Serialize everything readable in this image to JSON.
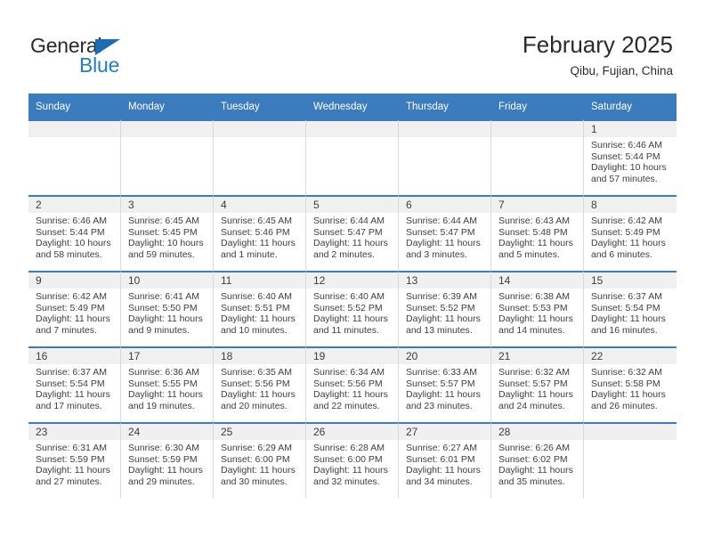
{
  "logo": {
    "word1": "General",
    "word2": "Blue",
    "triangle_color": "#1c6cb5",
    "blue_color": "#1f7ec4"
  },
  "header": {
    "title": "February 2025",
    "subtitle": "Qibu, Fujian, China"
  },
  "theme": {
    "header_bg": "#3a7cbe",
    "daynum_bg": "#f0f0f0",
    "cell_border": "#d9d9d9"
  },
  "weekday_headers": [
    "Sunday",
    "Monday",
    "Tuesday",
    "Wednesday",
    "Thursday",
    "Friday",
    "Saturday"
  ],
  "weeks": [
    [
      {
        "day": "",
        "lines": []
      },
      {
        "day": "",
        "lines": []
      },
      {
        "day": "",
        "lines": []
      },
      {
        "day": "",
        "lines": []
      },
      {
        "day": "",
        "lines": []
      },
      {
        "day": "",
        "lines": []
      },
      {
        "day": "1",
        "lines": [
          "Sunrise: 6:46 AM",
          "Sunset: 5:44 PM",
          "Daylight: 10 hours",
          "and 57 minutes."
        ]
      }
    ],
    [
      {
        "day": "2",
        "lines": [
          "Sunrise: 6:46 AM",
          "Sunset: 5:44 PM",
          "Daylight: 10 hours",
          "and 58 minutes."
        ]
      },
      {
        "day": "3",
        "lines": [
          "Sunrise: 6:45 AM",
          "Sunset: 5:45 PM",
          "Daylight: 10 hours",
          "and 59 minutes."
        ]
      },
      {
        "day": "4",
        "lines": [
          "Sunrise: 6:45 AM",
          "Sunset: 5:46 PM",
          "Daylight: 11 hours",
          "and 1 minute."
        ]
      },
      {
        "day": "5",
        "lines": [
          "Sunrise: 6:44 AM",
          "Sunset: 5:47 PM",
          "Daylight: 11 hours",
          "and 2 minutes."
        ]
      },
      {
        "day": "6",
        "lines": [
          "Sunrise: 6:44 AM",
          "Sunset: 5:47 PM",
          "Daylight: 11 hours",
          "and 3 minutes."
        ]
      },
      {
        "day": "7",
        "lines": [
          "Sunrise: 6:43 AM",
          "Sunset: 5:48 PM",
          "Daylight: 11 hours",
          "and 5 minutes."
        ]
      },
      {
        "day": "8",
        "lines": [
          "Sunrise: 6:42 AM",
          "Sunset: 5:49 PM",
          "Daylight: 11 hours",
          "and 6 minutes."
        ]
      }
    ],
    [
      {
        "day": "9",
        "lines": [
          "Sunrise: 6:42 AM",
          "Sunset: 5:49 PM",
          "Daylight: 11 hours",
          "and 7 minutes."
        ]
      },
      {
        "day": "10",
        "lines": [
          "Sunrise: 6:41 AM",
          "Sunset: 5:50 PM",
          "Daylight: 11 hours",
          "and 9 minutes."
        ]
      },
      {
        "day": "11",
        "lines": [
          "Sunrise: 6:40 AM",
          "Sunset: 5:51 PM",
          "Daylight: 11 hours",
          "and 10 minutes."
        ]
      },
      {
        "day": "12",
        "lines": [
          "Sunrise: 6:40 AM",
          "Sunset: 5:52 PM",
          "Daylight: 11 hours",
          "and 11 minutes."
        ]
      },
      {
        "day": "13",
        "lines": [
          "Sunrise: 6:39 AM",
          "Sunset: 5:52 PM",
          "Daylight: 11 hours",
          "and 13 minutes."
        ]
      },
      {
        "day": "14",
        "lines": [
          "Sunrise: 6:38 AM",
          "Sunset: 5:53 PM",
          "Daylight: 11 hours",
          "and 14 minutes."
        ]
      },
      {
        "day": "15",
        "lines": [
          "Sunrise: 6:37 AM",
          "Sunset: 5:54 PM",
          "Daylight: 11 hours",
          "and 16 minutes."
        ]
      }
    ],
    [
      {
        "day": "16",
        "lines": [
          "Sunrise: 6:37 AM",
          "Sunset: 5:54 PM",
          "Daylight: 11 hours",
          "and 17 minutes."
        ]
      },
      {
        "day": "17",
        "lines": [
          "Sunrise: 6:36 AM",
          "Sunset: 5:55 PM",
          "Daylight: 11 hours",
          "and 19 minutes."
        ]
      },
      {
        "day": "18",
        "lines": [
          "Sunrise: 6:35 AM",
          "Sunset: 5:56 PM",
          "Daylight: 11 hours",
          "and 20 minutes."
        ]
      },
      {
        "day": "19",
        "lines": [
          "Sunrise: 6:34 AM",
          "Sunset: 5:56 PM",
          "Daylight: 11 hours",
          "and 22 minutes."
        ]
      },
      {
        "day": "20",
        "lines": [
          "Sunrise: 6:33 AM",
          "Sunset: 5:57 PM",
          "Daylight: 11 hours",
          "and 23 minutes."
        ]
      },
      {
        "day": "21",
        "lines": [
          "Sunrise: 6:32 AM",
          "Sunset: 5:57 PM",
          "Daylight: 11 hours",
          "and 24 minutes."
        ]
      },
      {
        "day": "22",
        "lines": [
          "Sunrise: 6:32 AM",
          "Sunset: 5:58 PM",
          "Daylight: 11 hours",
          "and 26 minutes."
        ]
      }
    ],
    [
      {
        "day": "23",
        "lines": [
          "Sunrise: 6:31 AM",
          "Sunset: 5:59 PM",
          "Daylight: 11 hours",
          "and 27 minutes."
        ]
      },
      {
        "day": "24",
        "lines": [
          "Sunrise: 6:30 AM",
          "Sunset: 5:59 PM",
          "Daylight: 11 hours",
          "and 29 minutes."
        ]
      },
      {
        "day": "25",
        "lines": [
          "Sunrise: 6:29 AM",
          "Sunset: 6:00 PM",
          "Daylight: 11 hours",
          "and 30 minutes."
        ]
      },
      {
        "day": "26",
        "lines": [
          "Sunrise: 6:28 AM",
          "Sunset: 6:00 PM",
          "Daylight: 11 hours",
          "and 32 minutes."
        ]
      },
      {
        "day": "27",
        "lines": [
          "Sunrise: 6:27 AM",
          "Sunset: 6:01 PM",
          "Daylight: 11 hours",
          "and 34 minutes."
        ]
      },
      {
        "day": "28",
        "lines": [
          "Sunrise: 6:26 AM",
          "Sunset: 6:02 PM",
          "Daylight: 11 hours",
          "and 35 minutes."
        ]
      },
      {
        "day": "",
        "lines": []
      }
    ]
  ]
}
